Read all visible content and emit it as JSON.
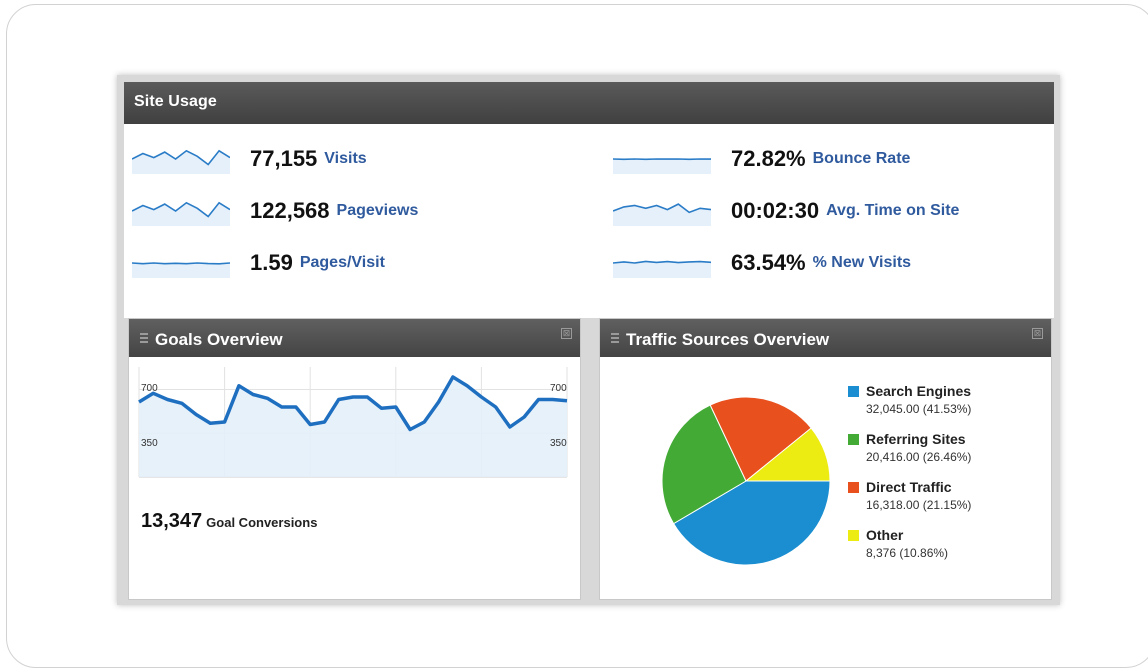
{
  "site_usage": {
    "title": "Site Usage",
    "metrics": [
      {
        "value": "77,155",
        "label": "Visits",
        "trend": [
          8,
          12,
          9,
          13,
          8,
          14,
          10,
          4,
          14,
          9
        ]
      },
      {
        "value": "122,568",
        "label": "Pageviews",
        "trend": [
          8,
          12,
          9,
          13,
          8,
          14,
          10,
          4,
          14,
          9
        ]
      },
      {
        "value": "1.59",
        "label": "Pages/Visit",
        "trend": [
          8,
          7.5,
          8,
          7.5,
          7.8,
          7.5,
          8,
          7.6,
          7.4,
          8
        ]
      },
      {
        "value": "72.82%",
        "label": "Bounce Rate",
        "trend": [
          8,
          7.8,
          8,
          7.8,
          8,
          7.9,
          8,
          7.8,
          8,
          7.9
        ]
      },
      {
        "value": "00:02:30",
        "label": "Avg. Time on Site",
        "trend": [
          8,
          11,
          12,
          10,
          12,
          9,
          13,
          7,
          10,
          9
        ]
      },
      {
        "value": "63.54%",
        "label": "% New Visits",
        "trend": [
          8,
          8.8,
          8,
          9.2,
          8.4,
          9,
          8.3,
          8.8,
          9,
          8.5
        ]
      }
    ]
  },
  "goals": {
    "title": "Goals Overview",
    "close_glyph": "⊠",
    "total": "13,347",
    "total_label": "Goal Conversions",
    "axis_left_top": "700",
    "axis_left_mid": "350",
    "axis_right_top": "700",
    "axis_right_mid": "350",
    "chart_data": {
      "type": "area",
      "y": [
        600,
        670,
        620,
        590,
        500,
        430,
        440,
        730,
        660,
        630,
        560,
        560,
        420,
        440,
        620,
        640,
        640,
        550,
        560,
        380,
        440,
        600,
        800,
        730,
        640,
        560,
        400,
        480,
        620,
        620,
        610
      ],
      "ylim": [
        0,
        880
      ],
      "ticks": [
        350,
        700
      ],
      "color": "#1f6fc0",
      "fill": "#e4f0fa"
    }
  },
  "traffic": {
    "title": "Traffic Sources Overview",
    "close_glyph": "⊠",
    "chart_data": {
      "type": "pie",
      "slices": [
        {
          "name": "Search Engines",
          "value": 41.53,
          "detail": "32,045.00 (41.53%)",
          "color": "#1a8ed0"
        },
        {
          "name": "Referring Sites",
          "value": 26.46,
          "detail": "20,416.00 (26.46%)",
          "color": "#43ab35"
        },
        {
          "name": "Direct Traffic",
          "value": 21.15,
          "detail": "16,318.00 (21.15%)",
          "color": "#e8501d"
        },
        {
          "name": "Other",
          "value": 10.86,
          "detail": "8,376 (10.86%)",
          "color": "#ecec12"
        }
      ]
    }
  },
  "sparkline_color": "#2a7cc7"
}
